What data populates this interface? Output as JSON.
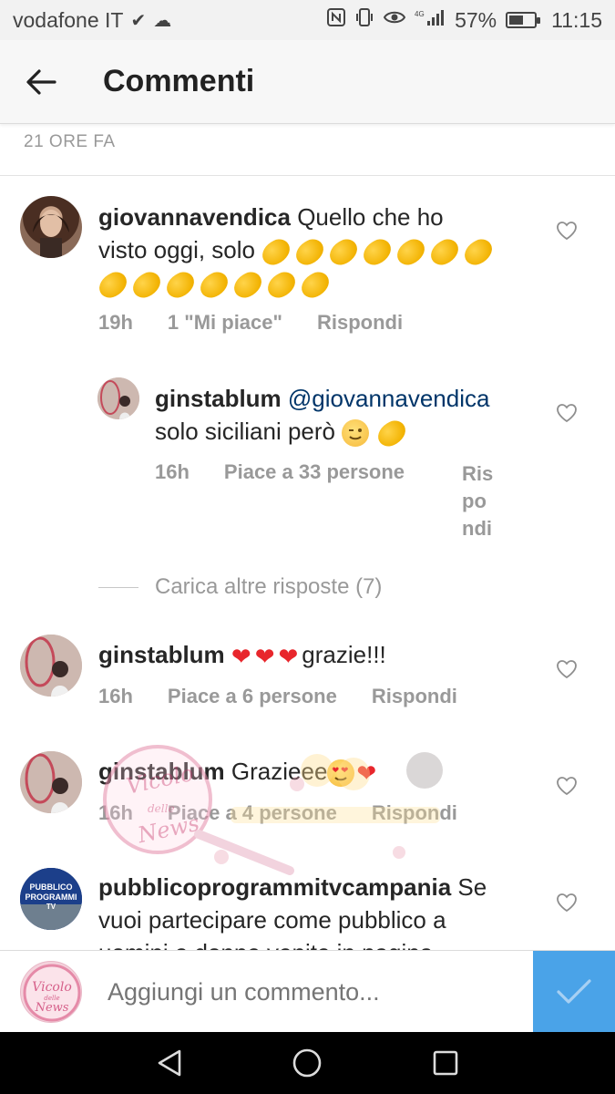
{
  "status_bar": {
    "carrier": "vodafone IT",
    "battery_percent": "57%",
    "battery_level": 0.57,
    "time": "11:15",
    "network": "4G"
  },
  "header": {
    "title": "Commenti"
  },
  "post_time": "21 ORE FA",
  "comments": [
    {
      "username": "giovannavendica",
      "text_line1": "Quello che ho",
      "text_line2": "visto oggi, solo",
      "time": "19h",
      "likes": "1 \"Mi piace\"",
      "reply_label": "Rispondi"
    },
    {
      "username": "ginstablum",
      "mention": "@giovannavendica",
      "text": "solo siciliani però",
      "time": "16h",
      "likes": "Piace a 33 persone",
      "reply_label_1": "Ris",
      "reply_label_2": "po",
      "reply_label_3": "ndi"
    },
    {
      "username": "ginstablum",
      "text": "grazie!!!",
      "time": "16h",
      "likes": "Piace a 6 persone",
      "reply_label": "Rispondi"
    },
    {
      "username": "ginstablum",
      "text": "Grazieee",
      "time": "16h",
      "likes": "Piace a 4 persone",
      "reply_label": "Rispondi"
    },
    {
      "username": "pubblicoprogrammitvcampania",
      "text_line1": "Se",
      "text_line2": "vuoi partecipare come pubblico a",
      "text_line3": "uomini e donne venite in pagina"
    }
  ],
  "load_more": "Carica altre risposte (7)",
  "composer": {
    "placeholder": "Aggiungi un commento..."
  },
  "avatar_text": {
    "pubblico_line1": "PUBBLICO",
    "pubblico_line2": "PROGRAMMI",
    "pubblico_line3": "TV",
    "vicolo_line1": "Vicolo",
    "vicolo_line2": "delle",
    "vicolo_line3": "News"
  },
  "colors": {
    "accent": "#4aa3e8",
    "mention": "#003569",
    "meta": "#999999",
    "heart": "#e8262c"
  }
}
